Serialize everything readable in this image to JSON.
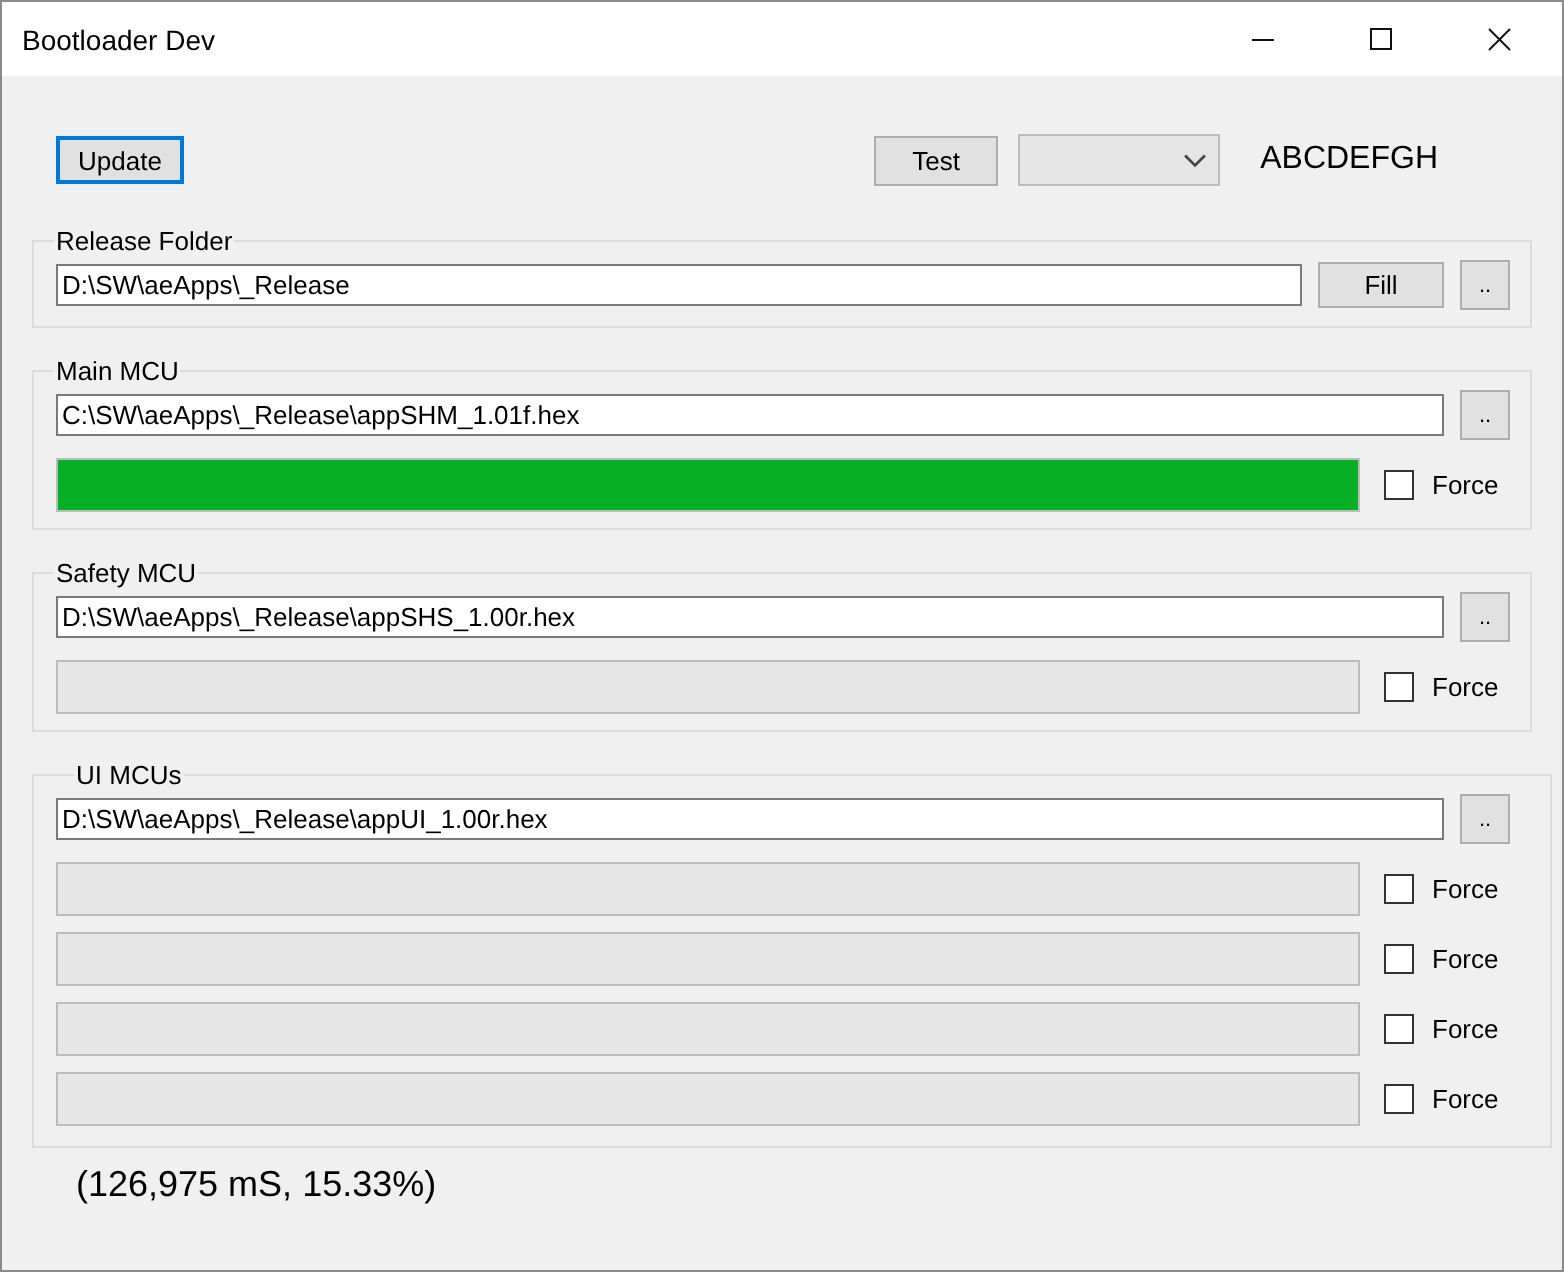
{
  "window": {
    "title": "Bootloader Dev"
  },
  "toolbar": {
    "update_button": "Update",
    "test_button": "Test",
    "label": "ABCDEFGH"
  },
  "groups": [
    {
      "title": "Release Folder",
      "path": "D:\\SW\\aeApps\\_Release",
      "buttons": [
        "Fill",
        ".."
      ]
    },
    {
      "title": "Main MCU",
      "path": "C:\\SW\\aeApps\\_Release\\appSHM_1.01f.hex",
      "buttons": [
        ".."
      ],
      "progress_rows": [
        {
          "level": 1,
          "force": "Force",
          "checked": false
        }
      ]
    },
    {
      "title": "Safety MCU",
      "path": "D:\\SW\\aeApps\\_Release\\appSHS_1.00r.hex",
      "buttons": [
        ".."
      ],
      "progress_rows": [
        {
          "level": 0,
          "force": "Force",
          "checked": false
        }
      ]
    },
    {
      "title": "UI MCUs",
      "path": "D:\\SW\\aeApps\\_Release\\appUI_1.00r.hex",
      "buttons": [
        ".."
      ],
      "progress_rows": [
        {
          "level": 0,
          "force": "Force",
          "checked": false
        },
        {
          "level": 0,
          "force": "Force",
          "checked": false
        },
        {
          "level": 0,
          "force": "Force",
          "checked": false
        },
        {
          "level": 0,
          "force": "Force",
          "checked": false
        }
      ]
    }
  ],
  "status": "(126,975 mS, 15.33%)"
}
